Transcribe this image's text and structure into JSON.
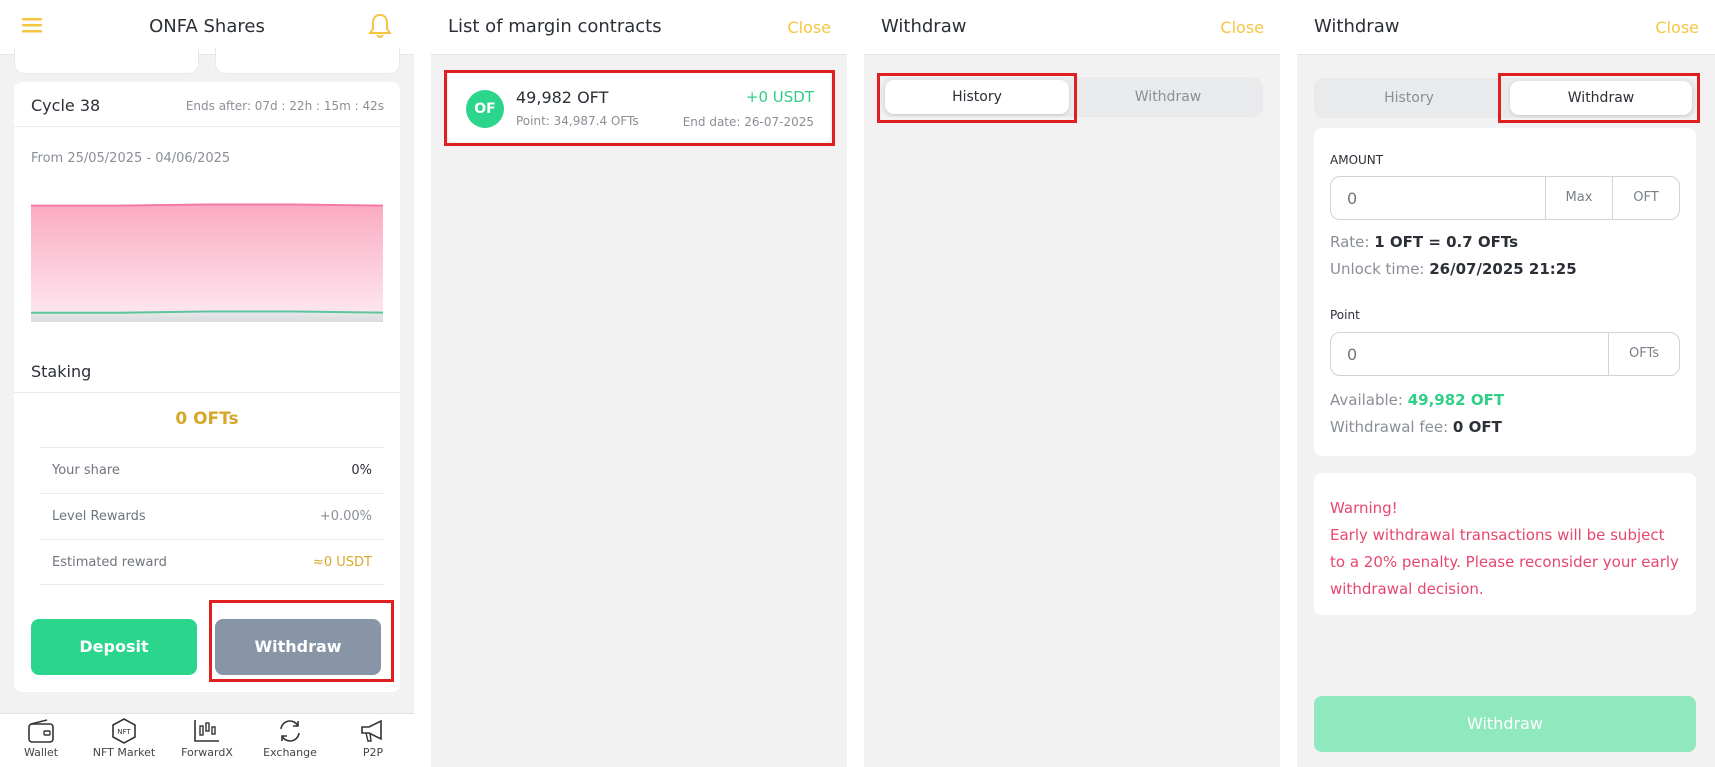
{
  "panel1": {
    "title": "ONFA Shares",
    "cycle": {
      "title": "Cycle 38",
      "ends": "Ends after: 07d : 22h : 15m : 42s",
      "range": "From 25/05/2025 - 04/06/2025"
    },
    "chart_data": {
      "type": "area",
      "title": "",
      "series": [
        {
          "values": [
            100,
            100,
            101,
            101,
            100
          ],
          "color": "#f47aa0"
        },
        {
          "values": [
            8,
            8,
            9,
            9,
            8
          ],
          "color": "#5cc59a"
        }
      ],
      "xlabel": "",
      "ylabel": "",
      "grid": false
    },
    "staking": {
      "title": "Staking",
      "amount": "0 OFTs"
    },
    "rows": [
      {
        "label": "Your share",
        "value": "0%"
      },
      {
        "label": "Level Rewards",
        "value": "+0.00%"
      },
      {
        "label": "Estimated reward",
        "value": "≈0 USDT"
      }
    ],
    "deposit_label": "Deposit",
    "withdraw_label": "Withdraw",
    "nav": [
      {
        "label": "Wallet",
        "icon": "wallet-icon"
      },
      {
        "label": "NFT Market",
        "icon": "nft-icon"
      },
      {
        "label": "ForwardX",
        "icon": "candlestick-icon"
      },
      {
        "label": "Exchange",
        "icon": "exchange-icon"
      },
      {
        "label": "P2P",
        "icon": "megaphone-icon"
      }
    ]
  },
  "panel2": {
    "title": "List of margin contracts",
    "close": "Close",
    "contract": {
      "logo": "OF",
      "amount": "49,982 OFT",
      "point": "Point: 34,987.4 OFTs",
      "profit": "+0 USDT",
      "end_date": "End date: 26-07-2025"
    }
  },
  "panel3": {
    "title": "Withdraw",
    "close": "Close",
    "tabs": [
      "History",
      "Withdraw"
    ]
  },
  "panel4": {
    "title": "Withdraw",
    "close": "Close",
    "tabs": [
      "History",
      "Withdraw"
    ],
    "amount_label": "AMOUNT",
    "amount_placeholder": "0",
    "max_label": "Max",
    "amount_unit": "OFT",
    "rate_label": "Rate: ",
    "rate_value": "1 OFT = 0.7 OFTs",
    "unlock_label": "Unlock time: ",
    "unlock_value": "26/07/2025 21:25",
    "point_label": "Point",
    "point_placeholder": "0",
    "point_unit": "OFTs",
    "available_label": "Available: ",
    "available_value": "49,982 OFT",
    "fee_label": "Withdrawal fee: ",
    "fee_value": "0 OFT",
    "warning_title": "Warning!",
    "warning_text": "Early withdrawal transactions will be subject to a 20% penalty. Please reconsider your early withdrawal decision.",
    "submit_label": "Withdraw"
  },
  "colors": {
    "accent": "#f5c542",
    "green": "#2fcf85",
    "warning": "#e8466f",
    "withdraw_btn": "#8795a6"
  }
}
